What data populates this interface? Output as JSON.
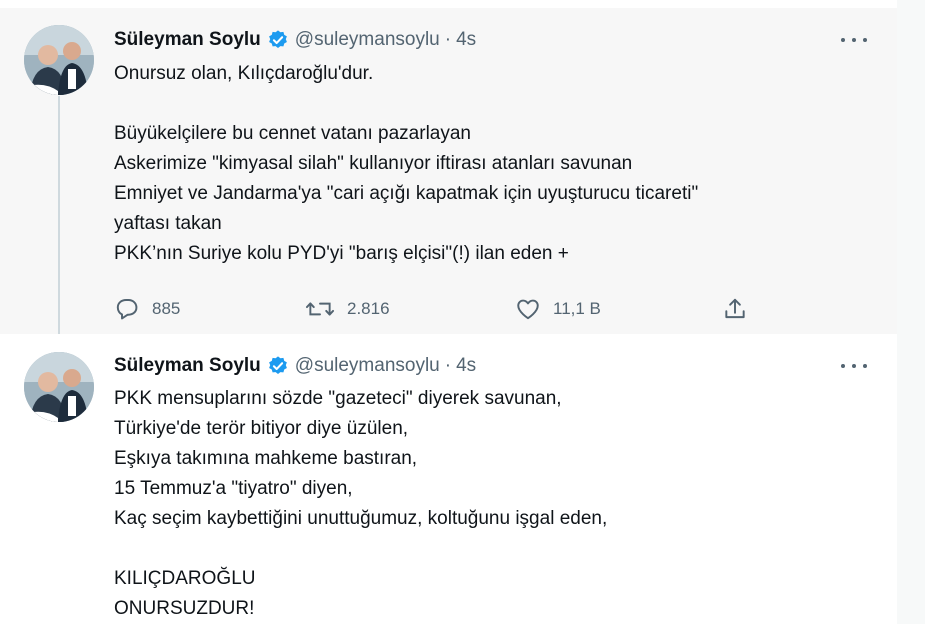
{
  "tweets": [
    {
      "author": {
        "name": "Süleyman Soylu",
        "handle": "@suleymansoylu",
        "verified": true
      },
      "separator": "·",
      "time": "4s",
      "lines": [
        "Onursuz olan, Kılıçdaroğlu'dur.",
        "",
        "Büyükelçilere bu cennet vatanı pazarlayan",
        "Askerimize \"kimyasal silah\" kullanıyor iftirası atanları savunan",
        "Emniyet ve Jandarma'ya \"cari açığı kapatmak için uyuşturucu ticareti\"",
        "yaftası takan",
        "PKK’nın Suriye kolu PYD'yi \"barış elçisi\"(!) ilan eden +"
      ],
      "actions": {
        "reply": {
          "icon": "reply-icon",
          "count": "885"
        },
        "retweet": {
          "icon": "retweet-icon",
          "count": "2.816"
        },
        "like": {
          "icon": "heart-icon",
          "count": "11,1 B"
        },
        "share": {
          "icon": "share-icon"
        }
      }
    },
    {
      "author": {
        "name": "Süleyman Soylu",
        "handle": "@suleymansoylu",
        "verified": true
      },
      "separator": "·",
      "time": "4s",
      "lines": [
        "PKK mensuplarını sözde \"gazeteci\" diyerek savunan,",
        "Türkiye'de terör bitiyor diye üzülen,",
        "Eşkıya takımına mahkeme bastıran,",
        "15 Temmuz'a \"tiyatro\" diyen,",
        "Kaç seçim kaybettiğini unuttuğumuz, koltuğunu işgal eden,",
        "",
        "KILIÇDAROĞLU",
        "ONURSUZDUR!"
      ]
    }
  ],
  "colors": {
    "text": "#0f1419",
    "secondary": "#536471",
    "verified": "#1d9bf0",
    "thread_line": "#cfd9de"
  }
}
